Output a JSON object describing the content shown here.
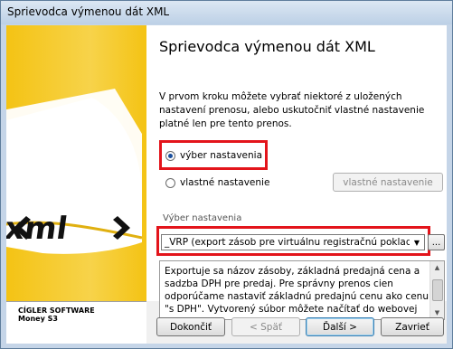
{
  "window": {
    "title": "Sprievodca výmenou dát XML"
  },
  "page": {
    "heading": "Sprievodca výmenou dát XML",
    "intro": "V prvom kroku môžete vybrať niektoré z uložených nastavení prenosu, alebo uskutočniť vlastné nastavenie platné len pre tento prenos."
  },
  "options": {
    "preset_label": "výber nastavenia",
    "custom_label": "vlastné nastavenie",
    "custom_button": "vlastné nastavenie",
    "selected": "výber nastavenia"
  },
  "preset": {
    "group_label": "Výber nastavenia",
    "selected_value": "_VRP (export zásob pre virtuálnu registračnú pokladnicu)",
    "browse_label": "..."
  },
  "description": "Exportuje sa názov zásoby, základná predajná cena a sadzba DPH pre predaj. Pre správny prenos cien odporúčame nastaviť základnú predajnú cenu ako cenu \"s DPH\". Vytvorený súbor môžete načítať do webovej",
  "branding": {
    "line1": "CÍGLER SOFTWARE",
    "line2": "Money S3"
  },
  "buttons": {
    "finish": "Dokončiť",
    "back": "< Späť",
    "next": "Ďalší >",
    "close": "Zavrieť"
  },
  "highlight_color": "#e3141b"
}
